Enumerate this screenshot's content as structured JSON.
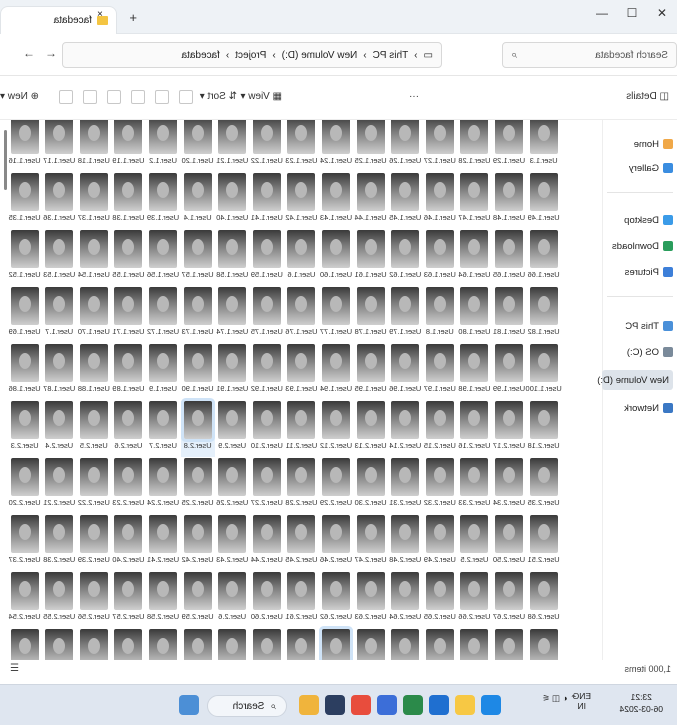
{
  "window": {
    "tab_title": "facedata",
    "tab_close": "×",
    "tab_add": "+",
    "btn_minimize": "—",
    "btn_maximize": "☐",
    "btn_close": "✕"
  },
  "address_bar": {
    "breadcrumb": [
      "This PC",
      "New Volume (D:)",
      "Project",
      "facedata"
    ],
    "separator": "›",
    "search_placeholder": "Search facedata",
    "nav_back": "←",
    "nav_forward": "→",
    "nav_up": "↑",
    "nav_refresh": "⟳"
  },
  "command_bar": {
    "new_label": "New",
    "sort_label": "Sort",
    "view_label": "View",
    "more_label": "···",
    "details_label": "Details"
  },
  "sidebar": {
    "home": "Home",
    "gallery": "Gallery",
    "desktop": "Desktop",
    "downloads": "Downloads",
    "pictures": "Pictures",
    "this_pc": "This PC",
    "os_c": "OS (C:)",
    "new_volume": "New Volume (D:)",
    "network": "Network"
  },
  "files": [
    [
      "User.1.16",
      "User.1.17",
      "User.1.18",
      "User.1.19",
      "User.1.2",
      "User.1.20",
      "User.1.21",
      "User.1.22",
      "User.1.23",
      "User.1.24",
      "User.1.25",
      "User.1.26",
      "User.1.27",
      "User.1.28",
      "User.1.29",
      "User.1.3"
    ],
    [
      "User.1.35",
      "User.1.36",
      "User.1.37",
      "User.1.38",
      "User.1.39",
      "User.1.4",
      "User.1.40",
      "User.1.41",
      "User.1.42",
      "User.1.43",
      "User.1.44",
      "User.1.45",
      "User.1.46",
      "User.1.47",
      "User.1.48",
      "User.1.49"
    ],
    [
      "User.1.52",
      "User.1.53",
      "User.1.54",
      "User.1.55",
      "User.1.56",
      "User.1.57",
      "User.1.58",
      "User.1.59",
      "User.1.6",
      "User.1.60",
      "User.1.61",
      "User.1.62",
      "User.1.63",
      "User.1.64",
      "User.1.65",
      "User.1.66"
    ],
    [
      "User.1.69",
      "User.1.7",
      "User.1.70",
      "User.1.71",
      "User.1.72",
      "User.1.73",
      "User.1.74",
      "User.1.75",
      "User.1.76",
      "User.1.77",
      "User.1.78",
      "User.1.79",
      "User.1.8",
      "User.1.80",
      "User.1.81",
      "User.1.82"
    ],
    [
      "User.1.86",
      "User.1.87",
      "User.1.88",
      "User.1.89",
      "User.1.9",
      "User.1.90",
      "User.1.91",
      "User.1.92",
      "User.1.93",
      "User.1.94",
      "User.1.95",
      "User.1.96",
      "User.1.97",
      "User.1.98",
      "User.1.99",
      "User.1.100"
    ],
    [
      "User.2.3",
      "User.2.4",
      "User.2.5",
      "User.2.6",
      "User.2.7",
      "User.2.8",
      "User.2.9",
      "User.2.10",
      "User.2.11",
      "User.2.12",
      "User.2.13",
      "User.2.14",
      "User.2.15",
      "User.2.16",
      "User.2.17",
      "User.2.18"
    ],
    [
      "User.2.20",
      "User.2.21",
      "User.2.22",
      "User.2.23",
      "User.2.24",
      "User.2.25",
      "User.2.26",
      "User.2.27",
      "User.2.28",
      "User.2.29",
      "User.2.30",
      "User.2.31",
      "User.2.32",
      "User.2.33",
      "User.2.34",
      "User.2.35"
    ],
    [
      "User.2.37",
      "User.2.38",
      "User.2.39",
      "User.2.40",
      "User.2.41",
      "User.2.42",
      "User.2.43",
      "User.2.44",
      "User.2.45",
      "User.2.46",
      "User.2.47",
      "User.2.48",
      "User.2.49",
      "User.2.5",
      "User.2.50",
      "User.2.51"
    ],
    [
      "User.2.54",
      "User.2.55",
      "User.2.56",
      "User.2.57",
      "User.2.58",
      "User.2.59",
      "User.2.6",
      "User.2.60",
      "User.2.61",
      "User.2.62",
      "User.2.63",
      "User.2.64",
      "User.2.65",
      "User.2.66",
      "User.2.67",
      "User.2.68"
    ],
    [
      "User.2.71",
      "User.2.72",
      "User.2.73",
      "User.2.74",
      "User.2.75",
      "User.2.76",
      "User.2.77",
      "User.2.78",
      "User.2.79",
      "User.2.8",
      "User.2.80",
      "User.2.81",
      "User.2.82",
      "User.2.83",
      "User.2.84",
      "User.2.85"
    ],
    [
      "",
      "",
      "",
      "",
      "",
      "",
      "",
      "",
      "",
      "",
      "",
      "",
      "",
      "",
      "",
      ""
    ]
  ],
  "selected_file": "User.2.8",
  "status": {
    "item_count": "1,000 items"
  },
  "taskbar": {
    "search_label": "Search",
    "lang_top": "ENG",
    "lang_bottom": "IN",
    "time": "23:21",
    "date": "06-03-2024"
  }
}
